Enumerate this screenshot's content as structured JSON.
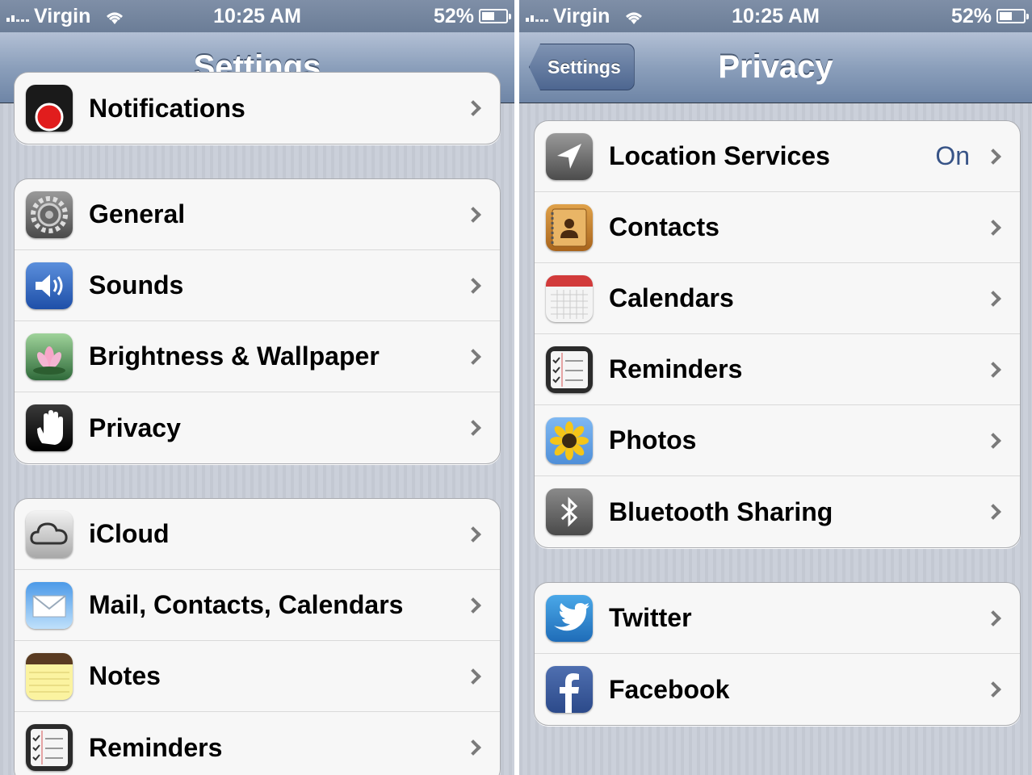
{
  "left": {
    "status": {
      "carrier": "Virgin",
      "time": "10:25 AM",
      "battery": "52%",
      "battery_level": 0.52
    },
    "nav": {
      "title": "Settings"
    },
    "groups": [
      {
        "items": [
          {
            "label": "Notifications",
            "icon": "notifications-icon"
          }
        ]
      },
      {
        "items": [
          {
            "label": "General",
            "icon": "gear-icon"
          },
          {
            "label": "Sounds",
            "icon": "speaker-icon"
          },
          {
            "label": "Brightness & Wallpaper",
            "icon": "flower-icon"
          },
          {
            "label": "Privacy",
            "icon": "hand-icon"
          }
        ]
      },
      {
        "items": [
          {
            "label": "iCloud",
            "icon": "cloud-icon"
          },
          {
            "label": "Mail, Contacts, Calendars",
            "icon": "envelope-icon"
          },
          {
            "label": "Notes",
            "icon": "notepad-icon"
          },
          {
            "label": "Reminders",
            "icon": "checklist-icon"
          }
        ]
      }
    ]
  },
  "right": {
    "status": {
      "carrier": "Virgin",
      "time": "10:25 AM",
      "battery": "52%",
      "battery_level": 0.52
    },
    "nav": {
      "title": "Privacy",
      "back_label": "Settings"
    },
    "groups": [
      {
        "items": [
          {
            "label": "Location Services",
            "value": "On",
            "icon": "location-arrow-icon"
          },
          {
            "label": "Contacts",
            "icon": "contacts-book-icon"
          },
          {
            "label": "Calendars",
            "icon": "calendar-icon"
          },
          {
            "label": "Reminders",
            "icon": "checklist-icon"
          },
          {
            "label": "Photos",
            "icon": "sunflower-icon"
          },
          {
            "label": "Bluetooth Sharing",
            "icon": "bluetooth-icon"
          }
        ]
      },
      {
        "items": [
          {
            "label": "Twitter",
            "icon": "twitter-bird-icon"
          },
          {
            "label": "Facebook",
            "icon": "facebook-icon"
          }
        ]
      }
    ]
  },
  "colors": {
    "nav_gradient_top": "#b3c0d5",
    "nav_gradient_bottom": "#6e85a6",
    "value_blue": "#385487",
    "cell_bg": "#f7f7f7"
  }
}
